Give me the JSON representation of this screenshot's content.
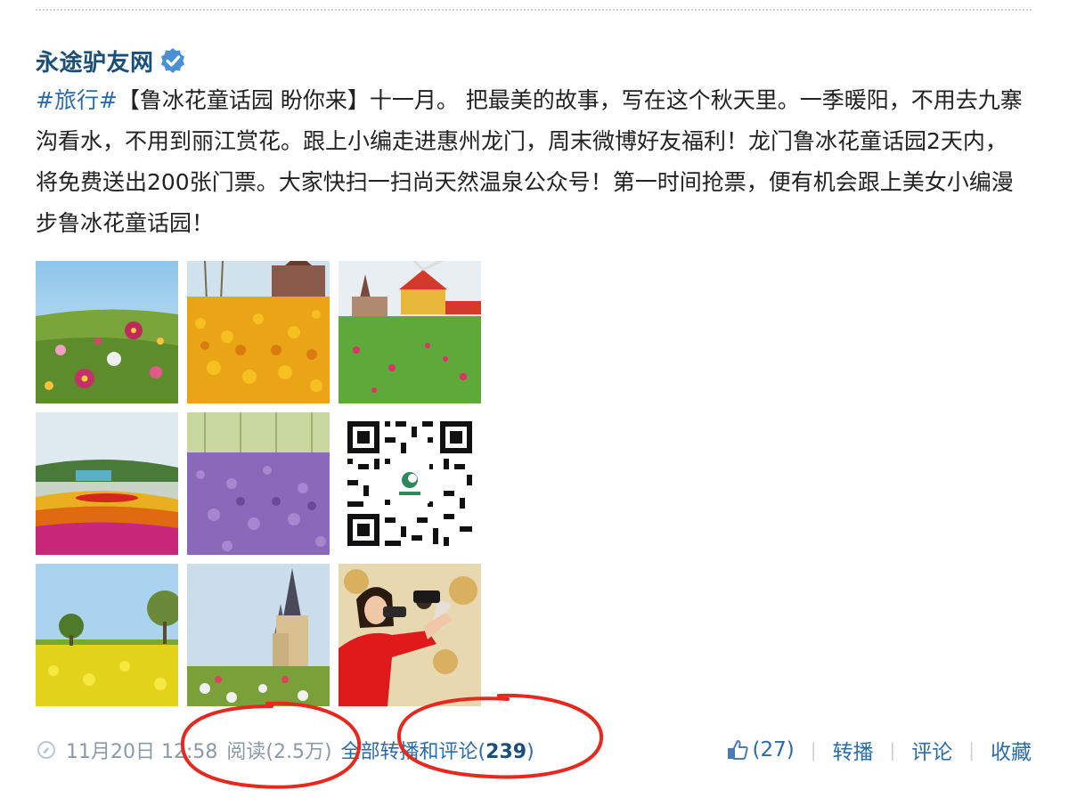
{
  "post": {
    "author": "永途驴友网",
    "content_tag": "#旅行#",
    "content_text": "【鲁冰花童话园 盼你来】十一月。 把最美的故事，写在这个秋天里。一季暖阳，不用去九寨沟看水，不用到丽江赏花。跟上小编走进惠州龙门，周末微博好友福利！龙门鲁冰花童话园2天内，将免费送出200张门票。大家快扫一扫尚天然温泉公众号！第一时间抢票，便有机会跟上美女小编漫步鲁冰花童话园！"
  },
  "meta": {
    "time": "11月20日 12:58",
    "reads": "阅读(2.5万)",
    "all_label": "全部转播和评论(",
    "all_count": "239",
    "all_close": ")"
  },
  "actions": {
    "like_count": "(27)",
    "forward": "转播",
    "comment": "评论",
    "favorite": "收藏",
    "separator": "|"
  },
  "colors": {
    "link": "#2a6cab",
    "author": "#1a4f7a",
    "meta": "#8a9aa8",
    "annotation": "#e8281e"
  }
}
